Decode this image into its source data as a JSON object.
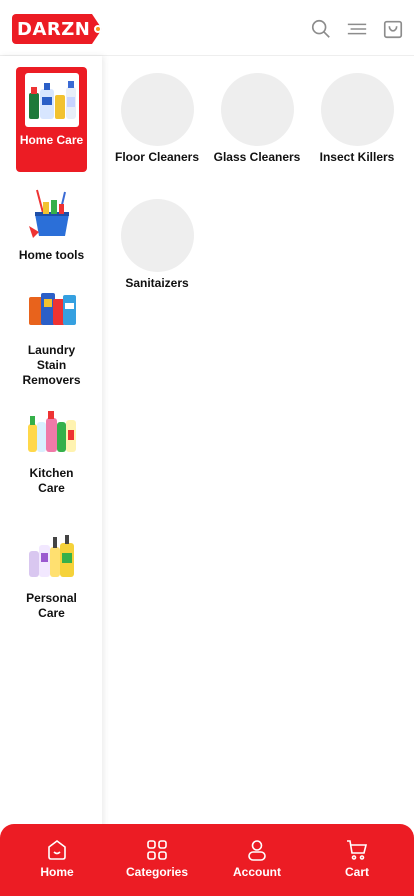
{
  "header": {
    "logo_text": "DARZN",
    "icons": [
      "search-icon",
      "menu-icon",
      "bag-icon"
    ]
  },
  "colors": {
    "brand_red": "#ec1c24",
    "logo_accent": "#f7941d",
    "placeholder_gray": "#eeeeee"
  },
  "sidebar": {
    "items": [
      {
        "label": "Home Care",
        "active": true
      },
      {
        "label": "Home tools",
        "active": false
      },
      {
        "label": "Laundry Stain Removers",
        "active": false
      },
      {
        "label": "Kitchen Care",
        "active": false
      },
      {
        "label": "Personal Care",
        "active": false
      }
    ]
  },
  "subcategories": [
    {
      "label": "Floor Cleaners"
    },
    {
      "label": "Glass Cleaners"
    },
    {
      "label": "Insect Killers"
    },
    {
      "label": "Sanitaizers"
    }
  ],
  "bottom_nav": {
    "items": [
      {
        "label": "Home",
        "icon": "home-icon"
      },
      {
        "label": "Categories",
        "icon": "grid-icon"
      },
      {
        "label": "Account",
        "icon": "user-icon"
      },
      {
        "label": "Cart",
        "icon": "cart-icon"
      }
    ]
  }
}
